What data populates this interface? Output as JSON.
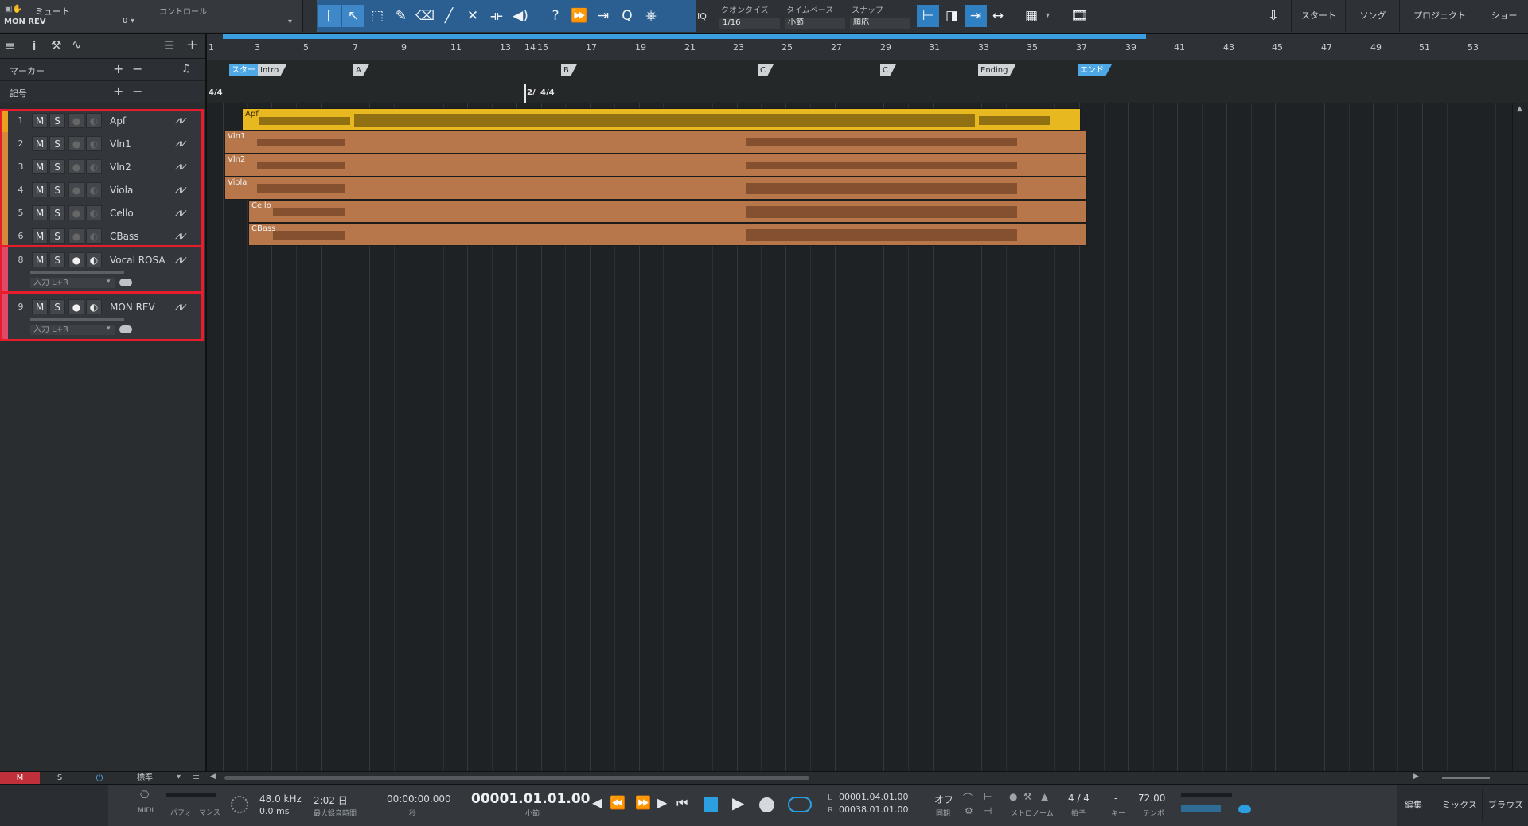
{
  "toolbar": {
    "mute_label": "ミュート",
    "control_label": "コントロール",
    "track_name": "MON REV",
    "control_value": "0",
    "quantize_label": "クオンタイズ",
    "quantize_value": "1/16",
    "timebase_label": "タイムベース",
    "timebase_value": "小節",
    "snap_label": "スナップ",
    "snap_value": "順応",
    "iq_label": "IQ",
    "nav": [
      "スタート",
      "ソング",
      "プロジェクト",
      "ショー"
    ]
  },
  "left_panel": {
    "marker_label": "マーカー",
    "signature_label": "記号",
    "bottom_buttons": [
      "M",
      "S",
      "標準"
    ]
  },
  "tracks": [
    {
      "num": "1",
      "name": "Apf",
      "color": "#e8a21f"
    },
    {
      "num": "2",
      "name": "Vln1",
      "color": "#d48a3a"
    },
    {
      "num": "3",
      "name": "Vln2",
      "color": "#d48a3a"
    },
    {
      "num": "4",
      "name": "Viola",
      "color": "#d48a3a"
    },
    {
      "num": "5",
      "name": "Cello",
      "color": "#d48a3a"
    },
    {
      "num": "6",
      "name": "CBass",
      "color": "#d48a3a"
    },
    {
      "num": "8",
      "name": "Vocal ROSA",
      "color": "#e04a6a",
      "input": "入力 L+R"
    },
    {
      "num": "9",
      "name": "MON REV",
      "color": "#e04a6a",
      "input": "入力 L+R"
    }
  ],
  "track_buttons": {
    "mute": "M",
    "solo": "S"
  },
  "ruler": {
    "bars": [
      "1",
      "3",
      "5",
      "7",
      "9",
      "11",
      "13",
      "14",
      "15",
      "17",
      "19",
      "21",
      "23",
      "25",
      "27",
      "29",
      "31",
      "33",
      "35",
      "37",
      "39",
      "41",
      "43",
      "45",
      "47",
      "49",
      "51",
      "53"
    ]
  },
  "markers": [
    "スタート",
    "Intro",
    "A",
    "B",
    "C",
    "C",
    "Ending",
    "エンド"
  ],
  "signatures": [
    "4/4",
    "2/",
    "4/4"
  ],
  "clips": [
    "Apf",
    "Vln1",
    "Vln2",
    "Viola",
    "Cello",
    "CBass"
  ],
  "transport": {
    "midi_label": "MIDI",
    "performance_label": "パフォーマンス",
    "sample_rate": "48.0 kHz",
    "latency": "0.0 ms",
    "record_time": "2:02 日",
    "record_time_label": "最大録音時間",
    "time": "00:00:00.000",
    "time_unit": "秒",
    "position": "00001.01.01.00",
    "position_unit": "小節",
    "loop_l_label": "L",
    "loop_l": "00001.04.01.00",
    "loop_r_label": "R",
    "loop_r": "00038.01.01.00",
    "sync_value": "オフ",
    "sync_label": "同期",
    "metronome_label": "メトロノーム",
    "signature_value": "4 / 4",
    "signature_label": "拍子",
    "key_value": "-",
    "key_label": "キー",
    "tempo_value": "72.00",
    "tempo_label": "テンポ",
    "views": [
      "編集",
      "ミックス",
      "ブラウズ"
    ]
  }
}
